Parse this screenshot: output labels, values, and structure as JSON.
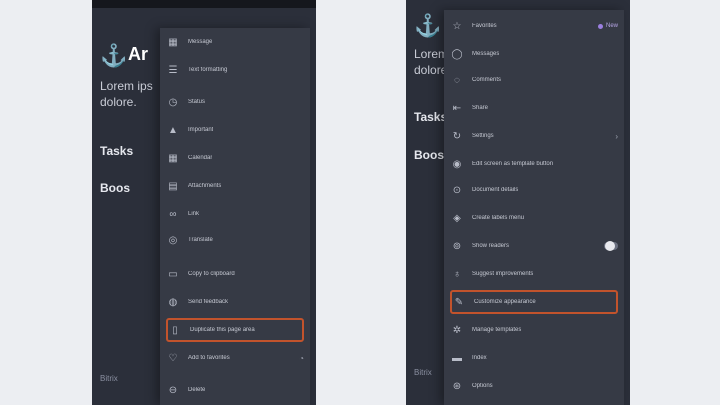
{
  "left_screen": {
    "background_app": {
      "title": "Ar",
      "subtitle_lines": [
        "Lorem ips",
        "dolore."
      ],
      "section_1": "Tasks",
      "section_2": "Boos",
      "footer": "Bitrix"
    },
    "menu_items": [
      {
        "icon": "message-icon",
        "label": "Message"
      },
      {
        "icon": "format-icon",
        "label": "Text formatting"
      },
      {
        "icon": "clock-icon",
        "label": "Status"
      },
      {
        "icon": "flag-icon",
        "label": "Important"
      },
      {
        "icon": "calendar-icon",
        "label": "Calendar"
      },
      {
        "icon": "tag-icon",
        "label": "Attachments"
      },
      {
        "icon": "link-icon",
        "label": "Link"
      },
      {
        "icon": "globe-icon",
        "label": "Translate"
      },
      {
        "icon": "clipboard-icon",
        "label": "Copy to clipboard"
      },
      {
        "icon": "comment-icon",
        "label": "Send feedback"
      },
      {
        "icon": "copy-icon",
        "label": "Duplicate this page area"
      },
      {
        "icon": "heart-icon",
        "label": "Add to favorites"
      },
      {
        "icon": "trash-icon",
        "label": "Delete"
      }
    ]
  },
  "right_screen": {
    "background_app": {
      "subtitle_lines": [
        "Lorem",
        "dolore."
      ],
      "section_1": "Tasks",
      "section_2": "Boos",
      "footer": "Bitrix"
    },
    "badge_text": "New",
    "menu_items": [
      {
        "icon": "star-icon",
        "label": "Favorites"
      },
      {
        "icon": "message-icon",
        "label": "Messages"
      },
      {
        "icon": "chat-icon",
        "label": "Comments"
      },
      {
        "icon": "share-icon",
        "label": "Share"
      },
      {
        "icon": "settings-icon",
        "label": "Settings"
      },
      {
        "icon": "edit-icon",
        "label": "Edit screen as template button"
      },
      {
        "icon": "info-icon",
        "label": "Document details"
      },
      {
        "icon": "tag-icon",
        "label": "Create labels menu"
      },
      {
        "icon": "lock-icon",
        "label": "Show readers"
      },
      {
        "icon": "lightbulb-icon",
        "label": "Suggest improvements"
      },
      {
        "icon": "pencil-icon",
        "label": "Customize appearance"
      },
      {
        "icon": "gear-icon",
        "label": "Manage templates"
      },
      {
        "icon": "folder-icon",
        "label": "Index"
      },
      {
        "icon": "logout-icon",
        "label": "Options"
      }
    ]
  }
}
